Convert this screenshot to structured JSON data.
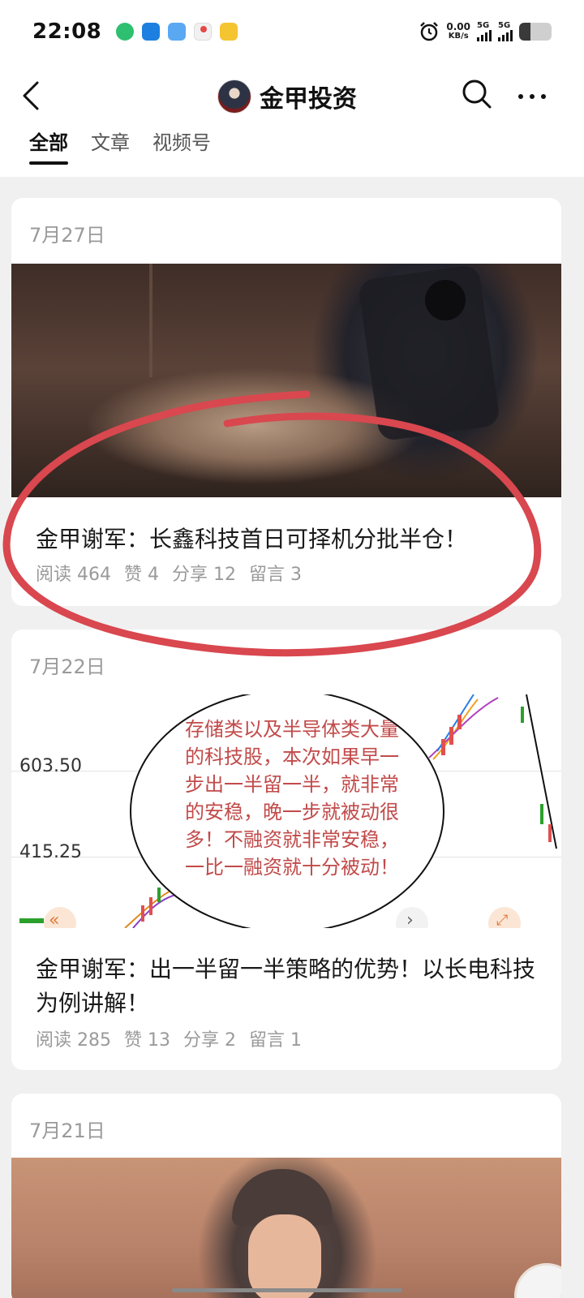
{
  "status_bar": {
    "time": "22:08",
    "speed_value": "0.00",
    "speed_unit": "KB/s",
    "net_1": "5G",
    "net_2": "5G",
    "app_icons": [
      "wechat-like-green-icon",
      "blue-app-icon",
      "blue-cloud-app-icon",
      "map-pin-app-icon",
      "yellow-hand-app-icon"
    ],
    "alarm_icon": "alarm-clock-icon",
    "battery_level": 0.35
  },
  "header": {
    "back_icon": "chevron-left-icon",
    "account_name": "金甲投资",
    "search_icon": "search-icon",
    "more_icon": "more-dots-icon",
    "tabs": [
      {
        "label": "全部",
        "active": true
      },
      {
        "label": "文章",
        "active": false
      },
      {
        "label": "视频号",
        "active": false
      }
    ]
  },
  "posts": [
    {
      "date": "7月27日",
      "title": "金甲谢军：长鑫科技首日可择机分批半仓！",
      "stats": {
        "read": "阅读 464",
        "like": "赞 4",
        "share": "分享 12",
        "comment": "留言 3"
      }
    },
    {
      "date": "7月22日",
      "title": "金甲谢军：出一半留一半策略的优势！以长电科技为例讲解！",
      "stats": {
        "read": "阅读 285",
        "like": "赞 13",
        "share": "分享 2",
        "comment": "留言 1"
      },
      "chart_labels": [
        "603.50",
        "415.25"
      ],
      "note_text": "存储类以及半导体类大量的科技股，本次如果早一步出一半留一半，就非常的安稳，晚一步就被动很多！不融资就非常安稳，一比一融资就十分被动！"
    },
    {
      "date": "7月21日"
    }
  ],
  "colors": {
    "annotation_red": "#d9474f",
    "note_text_red": "#c24a4a",
    "background": "#f0f0f0",
    "card": "#ffffff",
    "meta_gray": "#9a9a9a"
  }
}
